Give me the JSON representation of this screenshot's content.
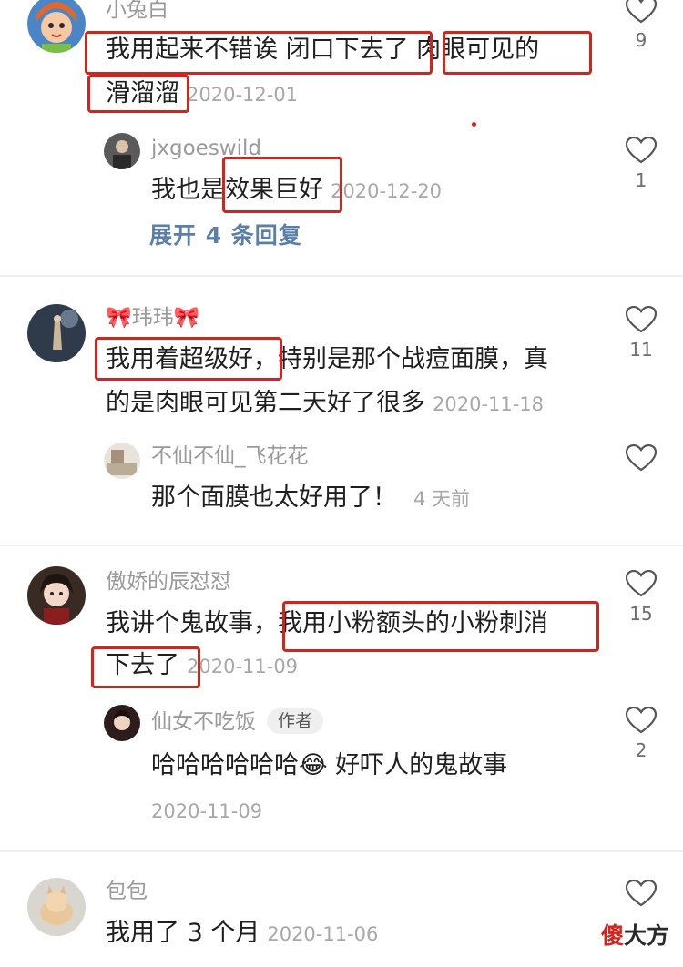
{
  "colors": {
    "highlight_box": "#d2241c",
    "link": "#5b7fa8",
    "meta_text": "#a8a8a8"
  },
  "comments": [
    {
      "username": "小兔白",
      "text_1": "我用起来不错诶   闭口下去了 肉眼可见的",
      "text_2": "滑溜溜",
      "timestamp": "2020-12-01",
      "likes": "9",
      "reply": {
        "username": "jxgoeswild",
        "text": "我也是效果巨好",
        "timestamp": "2020-12-20",
        "likes": "1"
      },
      "expand_label": "展开 4 条回复"
    },
    {
      "username": "🎀玮玮🎀",
      "text_1": "我用着超级好，特别是那个战痘面膜，真",
      "text_2": "的是肉眼可见第二天好了很多",
      "timestamp": "2020-11-18",
      "likes": "11",
      "reply": {
        "username": "不仙不仙_飞花花",
        "text": "那个面膜也太好用了！",
        "timestamp": "4 天前",
        "likes": ""
      }
    },
    {
      "username": "傲娇的辰怼怼",
      "text_1": "我讲个鬼故事，我用小粉额头的小粉刺消",
      "text_2": "下去了",
      "timestamp": "2020-11-09",
      "likes": "15",
      "reply": {
        "username": "仙女不吃饭",
        "badge": "作者",
        "text": "哈哈哈哈哈哈😂 好吓人的鬼故事",
        "timestamp": "2020-11-09",
        "likes": "2"
      }
    },
    {
      "username": "包包",
      "text_1": "我用了 3 个月",
      "timestamp": "2020-11-06",
      "likes": ""
    }
  ],
  "watermark": {
    "accent": "傻",
    "rest": "大方"
  }
}
